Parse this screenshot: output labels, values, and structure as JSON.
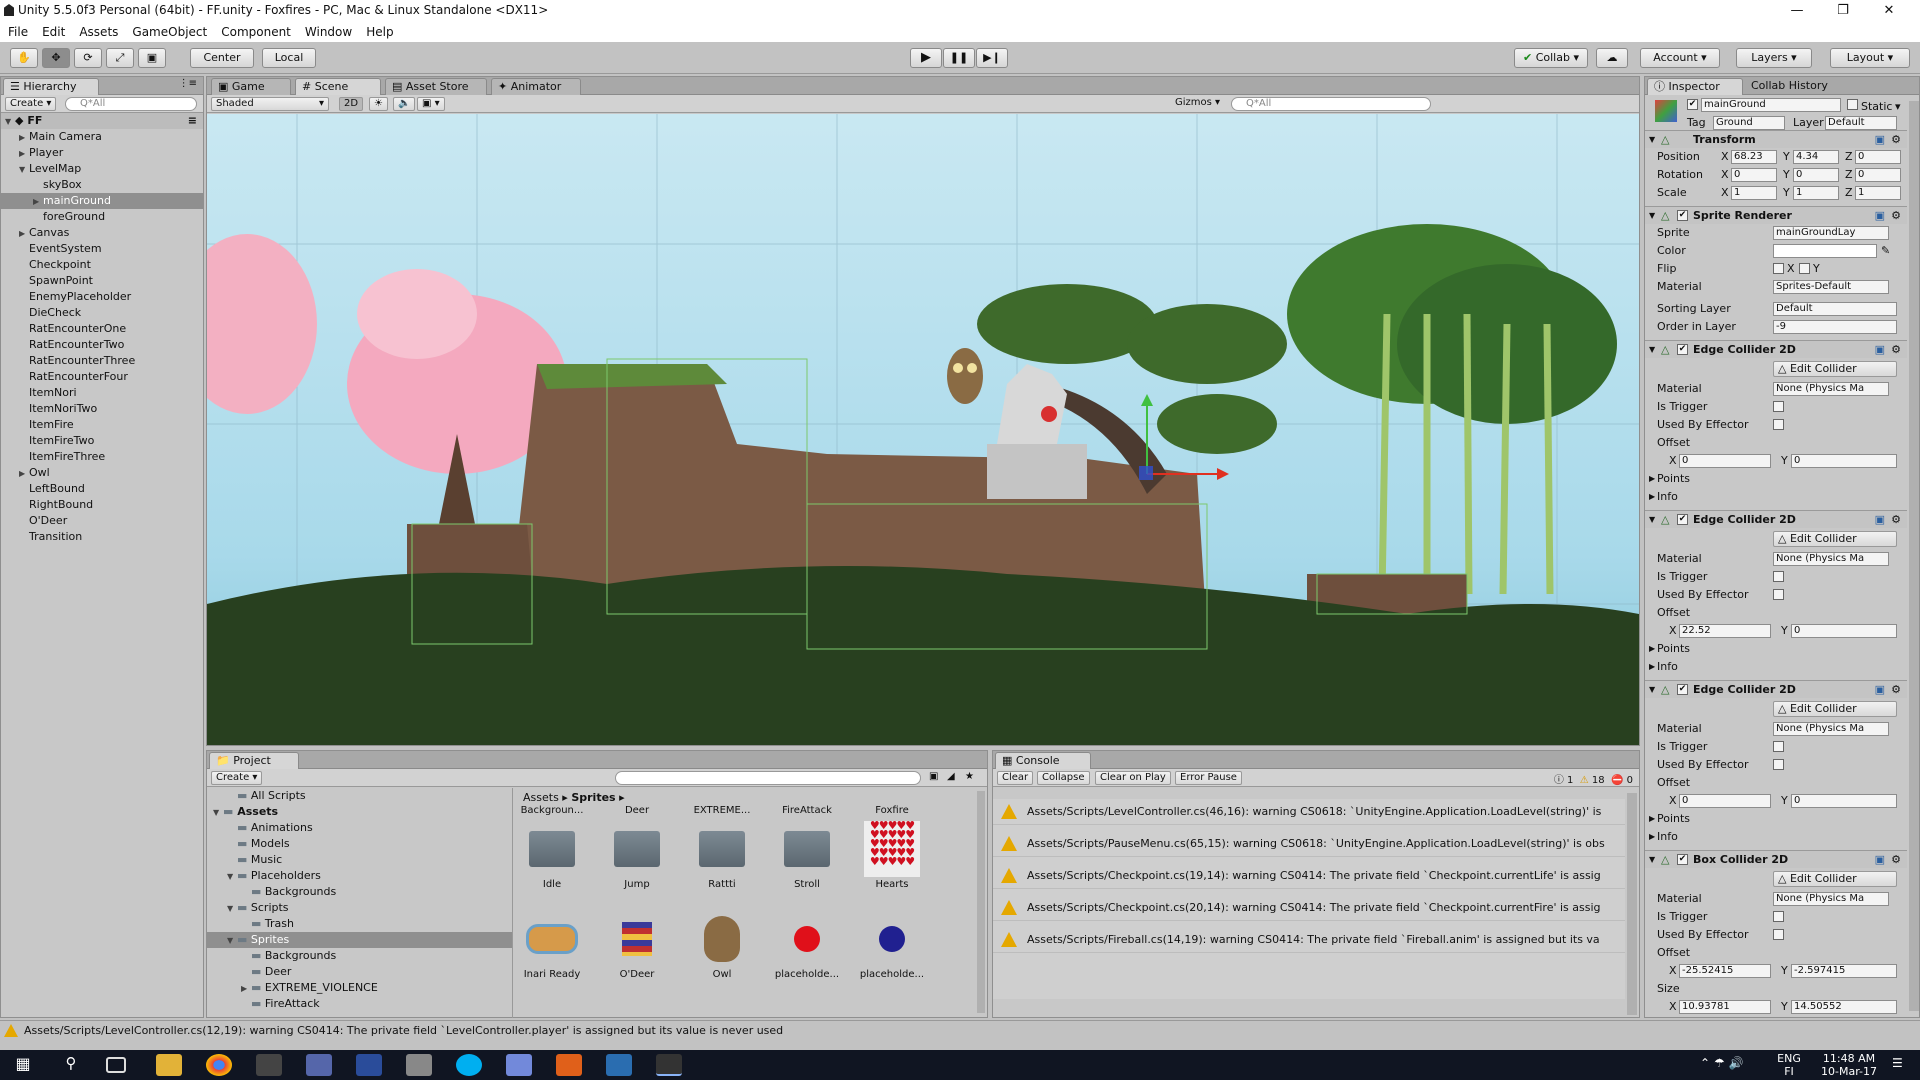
{
  "window": {
    "title": "Unity 5.5.0f3 Personal (64bit) - FF.unity - Foxfires - PC, Mac & Linux Standalone <DX11>"
  },
  "menu": [
    "File",
    "Edit",
    "Assets",
    "GameObject",
    "Component",
    "Window",
    "Help"
  ],
  "toolbar": {
    "pivot": "Center",
    "space": "Local",
    "collab": "Collab",
    "account": "Account",
    "layers": "Layers",
    "layout": "Layout"
  },
  "hierarchy": {
    "tab": "Hierarchy",
    "create": "Create",
    "search_placeholder": "Q*All",
    "scene": "FF",
    "items": [
      {
        "label": "Main Camera",
        "indent": 1,
        "arrow": "right"
      },
      {
        "label": "Player",
        "indent": 1,
        "arrow": "right"
      },
      {
        "label": "LevelMap",
        "indent": 1,
        "arrow": "down"
      },
      {
        "label": "skyBox",
        "indent": 2,
        "arrow": ""
      },
      {
        "label": "mainGround",
        "indent": 2,
        "arrow": "right",
        "selected": true
      },
      {
        "label": "foreGround",
        "indent": 2,
        "arrow": ""
      },
      {
        "label": "Canvas",
        "indent": 1,
        "arrow": "right"
      },
      {
        "label": "EventSystem",
        "indent": 1,
        "arrow": ""
      },
      {
        "label": "Checkpoint",
        "indent": 1,
        "arrow": ""
      },
      {
        "label": "SpawnPoint",
        "indent": 1,
        "arrow": ""
      },
      {
        "label": "EnemyPlaceholder",
        "indent": 1,
        "arrow": ""
      },
      {
        "label": "DieCheck",
        "indent": 1,
        "arrow": ""
      },
      {
        "label": "RatEncounterOne",
        "indent": 1,
        "arrow": ""
      },
      {
        "label": "RatEncounterTwo",
        "indent": 1,
        "arrow": ""
      },
      {
        "label": "RatEncounterThree",
        "indent": 1,
        "arrow": ""
      },
      {
        "label": "RatEncounterFour",
        "indent": 1,
        "arrow": ""
      },
      {
        "label": "ItemNori",
        "indent": 1,
        "arrow": ""
      },
      {
        "label": "ItemNoriTwo",
        "indent": 1,
        "arrow": ""
      },
      {
        "label": "ItemFire",
        "indent": 1,
        "arrow": ""
      },
      {
        "label": "ItemFireTwo",
        "indent": 1,
        "arrow": ""
      },
      {
        "label": "ItemFireThree",
        "indent": 1,
        "arrow": ""
      },
      {
        "label": "Owl",
        "indent": 1,
        "arrow": "right"
      },
      {
        "label": "LeftBound",
        "indent": 1,
        "arrow": ""
      },
      {
        "label": "RightBound",
        "indent": 1,
        "arrow": ""
      },
      {
        "label": "O'Deer",
        "indent": 1,
        "arrow": ""
      },
      {
        "label": "Transition",
        "indent": 1,
        "arrow": ""
      }
    ]
  },
  "center_tabs": [
    "Game",
    "Scene",
    "Asset Store",
    "Animator"
  ],
  "scene_bar": {
    "shading": "Shaded",
    "mode2d": "2D",
    "gizmos": "Gizmos",
    "search_placeholder": "Q*All"
  },
  "project": {
    "tab": "Project",
    "create": "Create",
    "tree": [
      {
        "label": "All Scripts",
        "indent": 1,
        "arrow": ""
      },
      {
        "label": "Assets",
        "indent": 0,
        "arrow": "down",
        "bold": true
      },
      {
        "label": "Animations",
        "indent": 1,
        "arrow": ""
      },
      {
        "label": "Models",
        "indent": 1,
        "arrow": ""
      },
      {
        "label": "Music",
        "indent": 1,
        "arrow": ""
      },
      {
        "label": "Placeholders",
        "indent": 1,
        "arrow": "down"
      },
      {
        "label": "Backgrounds",
        "indent": 2,
        "arrow": ""
      },
      {
        "label": "Scripts",
        "indent": 1,
        "arrow": "down"
      },
      {
        "label": "Trash",
        "indent": 2,
        "arrow": ""
      },
      {
        "label": "Sprites",
        "indent": 1,
        "arrow": "down",
        "selected": true
      },
      {
        "label": "Backgrounds",
        "indent": 2,
        "arrow": ""
      },
      {
        "label": "Deer",
        "indent": 2,
        "arrow": ""
      },
      {
        "label": "EXTREME_VIOLENCE",
        "indent": 2,
        "arrow": "right"
      },
      {
        "label": "FireAttack",
        "indent": 2,
        "arrow": ""
      }
    ],
    "breadcrumb": [
      "Assets",
      "Sprites"
    ],
    "row_top_labels": [
      "Backgroun...",
      "Deer",
      "EXTREME...",
      "FireAttack",
      "Foxfire"
    ],
    "row1": [
      {
        "label": "Idle",
        "kind": "folder"
      },
      {
        "label": "Jump",
        "kind": "folder"
      },
      {
        "label": "Rattti",
        "kind": "folder"
      },
      {
        "label": "Stroll",
        "kind": "folder"
      },
      {
        "label": "Hearts",
        "kind": "hearts"
      }
    ],
    "row2": [
      {
        "label": "Inari Ready",
        "kind": "food"
      },
      {
        "label": "O'Deer",
        "kind": "book"
      },
      {
        "label": "Owl",
        "kind": "owl"
      },
      {
        "label": "placeholde...",
        "kind": "red-dot",
        "color": "#e0101a"
      },
      {
        "label": "placeholde...",
        "kind": "blue-dot",
        "color": "#202090"
      }
    ]
  },
  "console": {
    "tab": "Console",
    "buttons": [
      "Clear",
      "Collapse",
      "Clear on Play",
      "Error Pause"
    ],
    "counts": {
      "info": "1",
      "warnings": "18",
      "errors": "0"
    },
    "lines": [
      "Assets/Scripts/LevelController.cs(46,16): warning CS0618: `UnityEngine.Application.LoadLevel(string)' is",
      "Assets/Scripts/PauseMenu.cs(65,15): warning CS0618: `UnityEngine.Application.LoadLevel(string)' is obs",
      "Assets/Scripts/Checkpoint.cs(19,14): warning CS0414: The private field `Checkpoint.currentLife' is assig",
      "Assets/Scripts/Checkpoint.cs(20,14): warning CS0414: The private field `Checkpoint.currentFire' is assig",
      "Assets/Scripts/Fireball.cs(14,19): warning CS0414: The private field `Fireball.anim' is assigned but its va"
    ]
  },
  "status_bar": "Assets/Scripts/LevelController.cs(12,19): warning CS0414: The private field `LevelController.player' is assigned but its value is never used",
  "inspector": {
    "tab": "Inspector",
    "tab2": "Collab History",
    "name": "mainGround",
    "static": "Static",
    "tag_label": "Tag",
    "tag": "Ground",
    "layer_label": "Layer",
    "layer": "Default",
    "transform": {
      "title": "Transform",
      "position": {
        "label": "Position",
        "x": "68.23",
        "y": "4.34",
        "z": "0"
      },
      "rotation": {
        "label": "Rotation",
        "x": "0",
        "y": "0",
        "z": "0"
      },
      "scale": {
        "label": "Scale",
        "x": "1",
        "y": "1",
        "z": "1"
      }
    },
    "sprite_renderer": {
      "title": "Sprite Renderer",
      "sprite_label": "Sprite",
      "sprite": "mainGroundLay",
      "color_label": "Color",
      "flip_label": "Flip",
      "flip_x": "X",
      "flip_y": "Y",
      "material_label": "Material",
      "material": "Sprites-Default",
      "sorting_label": "Sorting Layer",
      "sorting": "Default",
      "order_label": "Order in Layer",
      "order": "-9"
    },
    "edge_colliders": [
      {
        "title": "Edge Collider 2D",
        "offset_x": "0",
        "offset_y": "0"
      },
      {
        "title": "Edge Collider 2D",
        "offset_x": "22.52",
        "offset_y": "0"
      },
      {
        "title": "Edge Collider 2D",
        "offset_x": "0",
        "offset_y": "0"
      }
    ],
    "collider_labels": {
      "edit": "Edit Collider",
      "material": "Material",
      "material_value": "None (Physics Ma",
      "trigger": "Is Trigger",
      "effector": "Used By Effector",
      "offset": "Offset",
      "points": "Points",
      "info": "Info",
      "x": "X",
      "y": "Y"
    },
    "box_collider": {
      "title": "Box Collider 2D",
      "offset_x": "-25.52415",
      "offset_y": "-2.597415",
      "size_label": "Size",
      "size_x": "10.93781",
      "size_y": "14.50552"
    }
  },
  "taskbar": {
    "lang": "ENG",
    "lang2": "FI",
    "time": "11:48 AM",
    "date": "10-Mar-17"
  }
}
